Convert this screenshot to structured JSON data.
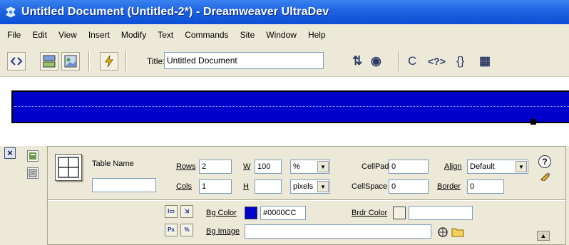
{
  "window": {
    "title": "Untitled Document (Untitled-2*) - Dreamweaver UltraDev",
    "app_icon": "dreamweaver-logo-icon"
  },
  "menu": {
    "items": [
      "File",
      "Edit",
      "View",
      "Insert",
      "Modify",
      "Text",
      "Commands",
      "Site",
      "Window",
      "Help"
    ]
  },
  "toolbar": {
    "title_label": "Title:",
    "title_value": "Untitled Document",
    "icons": [
      "code-view-icon",
      "code-design-view-icon",
      "design-view-icon",
      "live-data-icon",
      "file-management-icon",
      "preview-browser-icon",
      "refresh-icon",
      "reference-icon",
      "code-navigation-icon",
      "view-options-icon"
    ],
    "file_mgmt_glyph": "⇅",
    "preview_glyph": "◉",
    "refresh_glyph": "C",
    "reference_glyph": "<?>",
    "code_nav_glyph": "{}",
    "view_options_glyph": "▦"
  },
  "canvas": {
    "table_color": "#0000CC"
  },
  "inspector": {
    "close_glyph": "×",
    "table_name_label": "Table Name",
    "table_name_value": "",
    "rows_label": "Rows",
    "rows_value": "2",
    "cols_label": "Cols",
    "cols_value": "1",
    "w_label": "W",
    "w_value": "100",
    "w_unit": "%",
    "h_label": "H",
    "h_value": "",
    "h_unit": "pixels",
    "cellpad_label": "CellPad",
    "cellpad_value": "0",
    "cellspace_label": "CellSpace",
    "cellspace_value": "0",
    "align_label": "Align",
    "align_value": "Default",
    "border_label": "Border",
    "border_value": "0",
    "bgcolor_label": "Bg Color",
    "bgcolor_value": "#0000CC",
    "bgcolor_swatch": "#0000cc",
    "brdr_color_label": "Brdr Color",
    "brdr_color_value": "",
    "bgimage_label": "Bg Image",
    "bgimage_value": "",
    "help_glyph": "?",
    "expand_glyph": "▲"
  }
}
